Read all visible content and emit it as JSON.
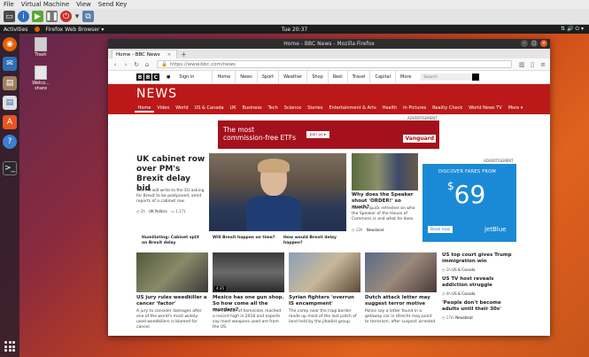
{
  "vbox": {
    "menu": [
      "File",
      "Virtual Machine",
      "View",
      "Send Key"
    ]
  },
  "guest": {
    "activities": "Activities",
    "app_name": "Firefox Web Browser ▾",
    "clock": "Tue 20:37",
    "desktop_icons": [
      {
        "label": "Trash"
      },
      {
        "label": "Welco... share"
      }
    ]
  },
  "firefox": {
    "window_title": "Home - BBC News - Mozilla Firefox",
    "tab_title": "Home - BBC News",
    "url": "https://www.bbc.com/news"
  },
  "bbc": {
    "signin": "Sign in",
    "global_nav": [
      "Home",
      "News",
      "Sport",
      "Weather",
      "Shop",
      "Reel",
      "Travel",
      "Capital",
      "More"
    ],
    "search_placeholder": "Search",
    "news_logo": "NEWS",
    "news_nav": [
      "Home",
      "Video",
      "World",
      "US & Canada",
      "UK",
      "Business",
      "Tech",
      "Science",
      "Stories",
      "Entertainment & Arts",
      "Health",
      "In Pictures",
      "Reality Check",
      "World News TV",
      "More ▾"
    ],
    "ad_label": "ADVERTISEMENT",
    "ad_top": {
      "line1": "The most",
      "line2": "commission-free ETFs",
      "button": "Join us ▸",
      "brand": "Vanguard"
    },
    "lead": {
      "headline": "UK cabinet row over PM's Brexit delay bid",
      "summary": "The PM will write to the EU asking for Brexit to be postponed, amid reports of a cabinet row.",
      "time": "2h",
      "section": "UK Politics",
      "comments": "1,171"
    },
    "related": [
      "Humiliating: Cabinet split on Brexit delay",
      "Will Brexit happen on time?",
      "How would Brexit delay happen?"
    ],
    "second": {
      "headline": "Why does the Speaker shout 'ORDER!' so much?",
      "summary": "Here's a quick refresher on who the Speaker of the House of Commons is and what he does.",
      "time": "12h",
      "section": "Newsbeat"
    },
    "ad_side": {
      "label": "ADVERTISEMENT",
      "line": "DISCOVER FARES FROM",
      "dollar": "$",
      "price": "69",
      "button": "Book now",
      "brand": "jetBlue"
    },
    "bottom": [
      {
        "headline": "US jury rules weedkiller a cancer 'factor'",
        "summary": "A jury to consider damages after one of the world's most widely-used weedkillers is blamed for cancer.",
        "video": false
      },
      {
        "headline": "Mexico has one gun shop. So how come all the murders?",
        "summary": "The number of homicides reached a record high in 2018 and experts say most weapons used are from the US.",
        "video": true,
        "duration": "4:35"
      },
      {
        "headline": "Syrian fighters 'overrun IS encampment'",
        "summary": "The camp near the Iraqi border made up most of the last patch of land held by the jihadist group.",
        "video": false
      },
      {
        "headline": "Dutch attack letter may suggest terror motive",
        "summary": "Police say a letter found in a getaway car in Utrecht may point to terrorism, after suspect arrested.",
        "video": false
      }
    ],
    "side_list": [
      {
        "headline": "US top court gives Trump immigration win",
        "time": "1h",
        "section": "US & Canada"
      },
      {
        "headline": "US TV host reveals addiction struggle",
        "time": "4h",
        "section": "US & Canada"
      },
      {
        "headline": "'People don't become adults until their 30s'",
        "time": "17m",
        "section": "Newsbeat"
      }
    ]
  }
}
